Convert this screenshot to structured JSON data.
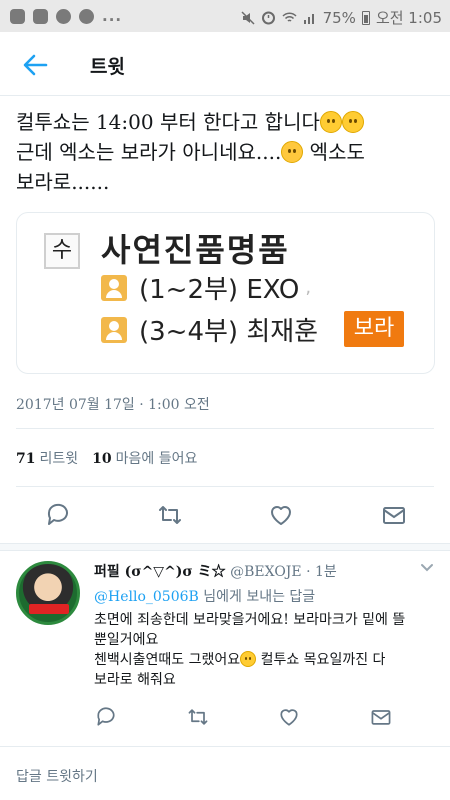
{
  "status_bar": {
    "battery": "75%",
    "time": "오전 1:05",
    "dots": "..."
  },
  "header": {
    "title": "트윗",
    "back_icon": "arrow-left-icon"
  },
  "tweet": {
    "text_line1": "컬투쇼는 14:00 부터 한다고 합니다",
    "text_line2": "근데 엑소는 보라가 아니네요....",
    "text_line2b": " 엑소도",
    "text_line3": "보라로......",
    "card": {
      "tag": "수",
      "title": "사연진품명품",
      "row1": "(1~2부) EXO",
      "row1_comma": ",",
      "row2": "(3~4부) 최재훈",
      "badge": "보라"
    },
    "timestamp": "2017년 07월 17일 · 1:00 오전",
    "retweet_count": "71",
    "retweet_label": "리트윗",
    "like_count": "10",
    "like_label": "마음에 들어요"
  },
  "reply": {
    "name": "퍼필 (σ^▽^)σ ミ☆",
    "handle": "@BEXOJE",
    "time": "· 1분",
    "avatar_text": "",
    "mention": "@Hello_0506B",
    "reply_suffix": " 님에게 보내는 답글",
    "text_line1": "초면에 죄송한데 보라맞을거에요! 보라마크가 밑에 뜰",
    "text_line2": "뿐일거에요",
    "text_line3a": "첸백시출연때도 그랬어요",
    "text_line3b": " 컬투쇼 목요일까진 다",
    "text_line4": "보라로 해줘요"
  },
  "compose": {
    "placeholder": "답글 트윗하기"
  },
  "colors": {
    "accent": "#1da1f2",
    "badge": "#f07a10",
    "muted": "#657786"
  }
}
